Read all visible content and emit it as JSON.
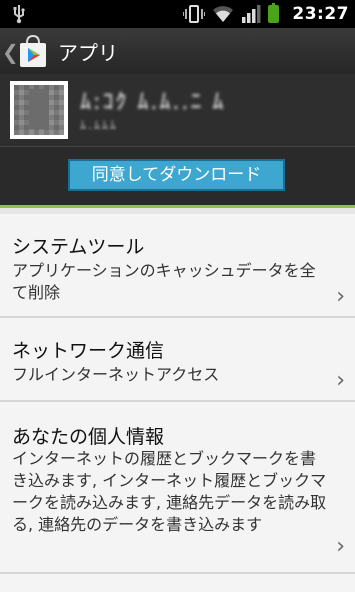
{
  "status_bar": {
    "time": "23:27"
  },
  "action_bar": {
    "title": "アプリ"
  },
  "app_header": {
    "app_name": "ﾑ:ｺｸ ﾑ.ﾑ..ﾆ ﾑ",
    "developer": "ﾑ.ﾑﾑﾑ"
  },
  "agree_button": {
    "label": "同意してダウンロード"
  },
  "permissions": [
    {
      "title": "システムツール",
      "description": "アプリケーションのキャッシュデータを全て削除"
    },
    {
      "title": "ネットワーク通信",
      "description": "フルインターネットアクセス"
    },
    {
      "title": "あなたの個人情報",
      "description": "インターネットの履歴とブックマークを書き込みます, インターネット履歴とブックマークを読み込みます, 連絡先データを読み取る, 連絡先のデータを書き込みます"
    }
  ],
  "colors": {
    "accent": "#8cc63f",
    "button": "#3ea7cf",
    "battery": "#4aa31a"
  },
  "icons": [
    "usb-icon",
    "vibrate-icon",
    "wifi-icon",
    "signal-icon",
    "battery-icon",
    "back-chevron-icon",
    "play-store-bag-icon",
    "chevron-right-icon"
  ]
}
